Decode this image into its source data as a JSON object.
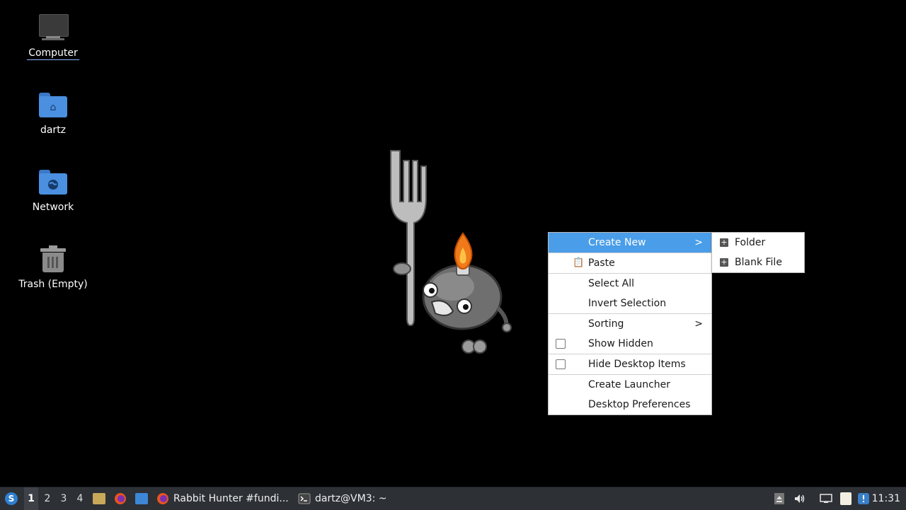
{
  "desktop": {
    "icons": [
      {
        "label": "Computer",
        "icon": "computer-icon"
      },
      {
        "label": "dartz",
        "icon": "home-folder-icon"
      },
      {
        "label": "Network",
        "icon": "network-folder-icon"
      },
      {
        "label": "Trash (Empty)",
        "icon": "trash-icon"
      }
    ]
  },
  "context_menu": {
    "items": [
      {
        "label": "Create New",
        "has_submenu": true,
        "active": true
      },
      {
        "label": "Paste",
        "icon": "clipboard-icon"
      },
      {
        "label": "Select All"
      },
      {
        "label": "Invert Selection"
      },
      {
        "label": "Sorting",
        "has_submenu": true
      },
      {
        "label": "Show Hidden",
        "checkbox": true,
        "checked": false
      },
      {
        "label": "Hide Desktop Items",
        "checkbox": true,
        "checked": false
      },
      {
        "label": "Create Launcher"
      },
      {
        "label": "Desktop Preferences"
      }
    ],
    "submenu": {
      "items": [
        {
          "label": "Folder",
          "icon": "new-item-icon"
        },
        {
          "label": "Blank File",
          "icon": "new-item-icon"
        }
      ]
    },
    "arrow_glyph": ">"
  },
  "taskbar": {
    "start_icon": "menu-logo-icon",
    "workspaces": [
      "1",
      "2",
      "3",
      "4"
    ],
    "current_workspace": "1",
    "launchers": [
      "file-manager-icon",
      "firefox-icon",
      "desktop-icon"
    ],
    "tasks": [
      {
        "label": "Rabbit Hunter #fundi...",
        "icon": "firefox-icon"
      },
      {
        "label": "dartz@VM3: ~",
        "icon": "terminal-icon"
      }
    ],
    "tray": [
      "eject-icon",
      "volume-icon",
      "network-icon",
      "notes-icon",
      "updates-icon"
    ],
    "clock": "11:31"
  },
  "colors": {
    "menu_highlight": "#4a9de8",
    "folder_blue": "#4a8fe0",
    "taskbar_bg": "#2d3035"
  }
}
